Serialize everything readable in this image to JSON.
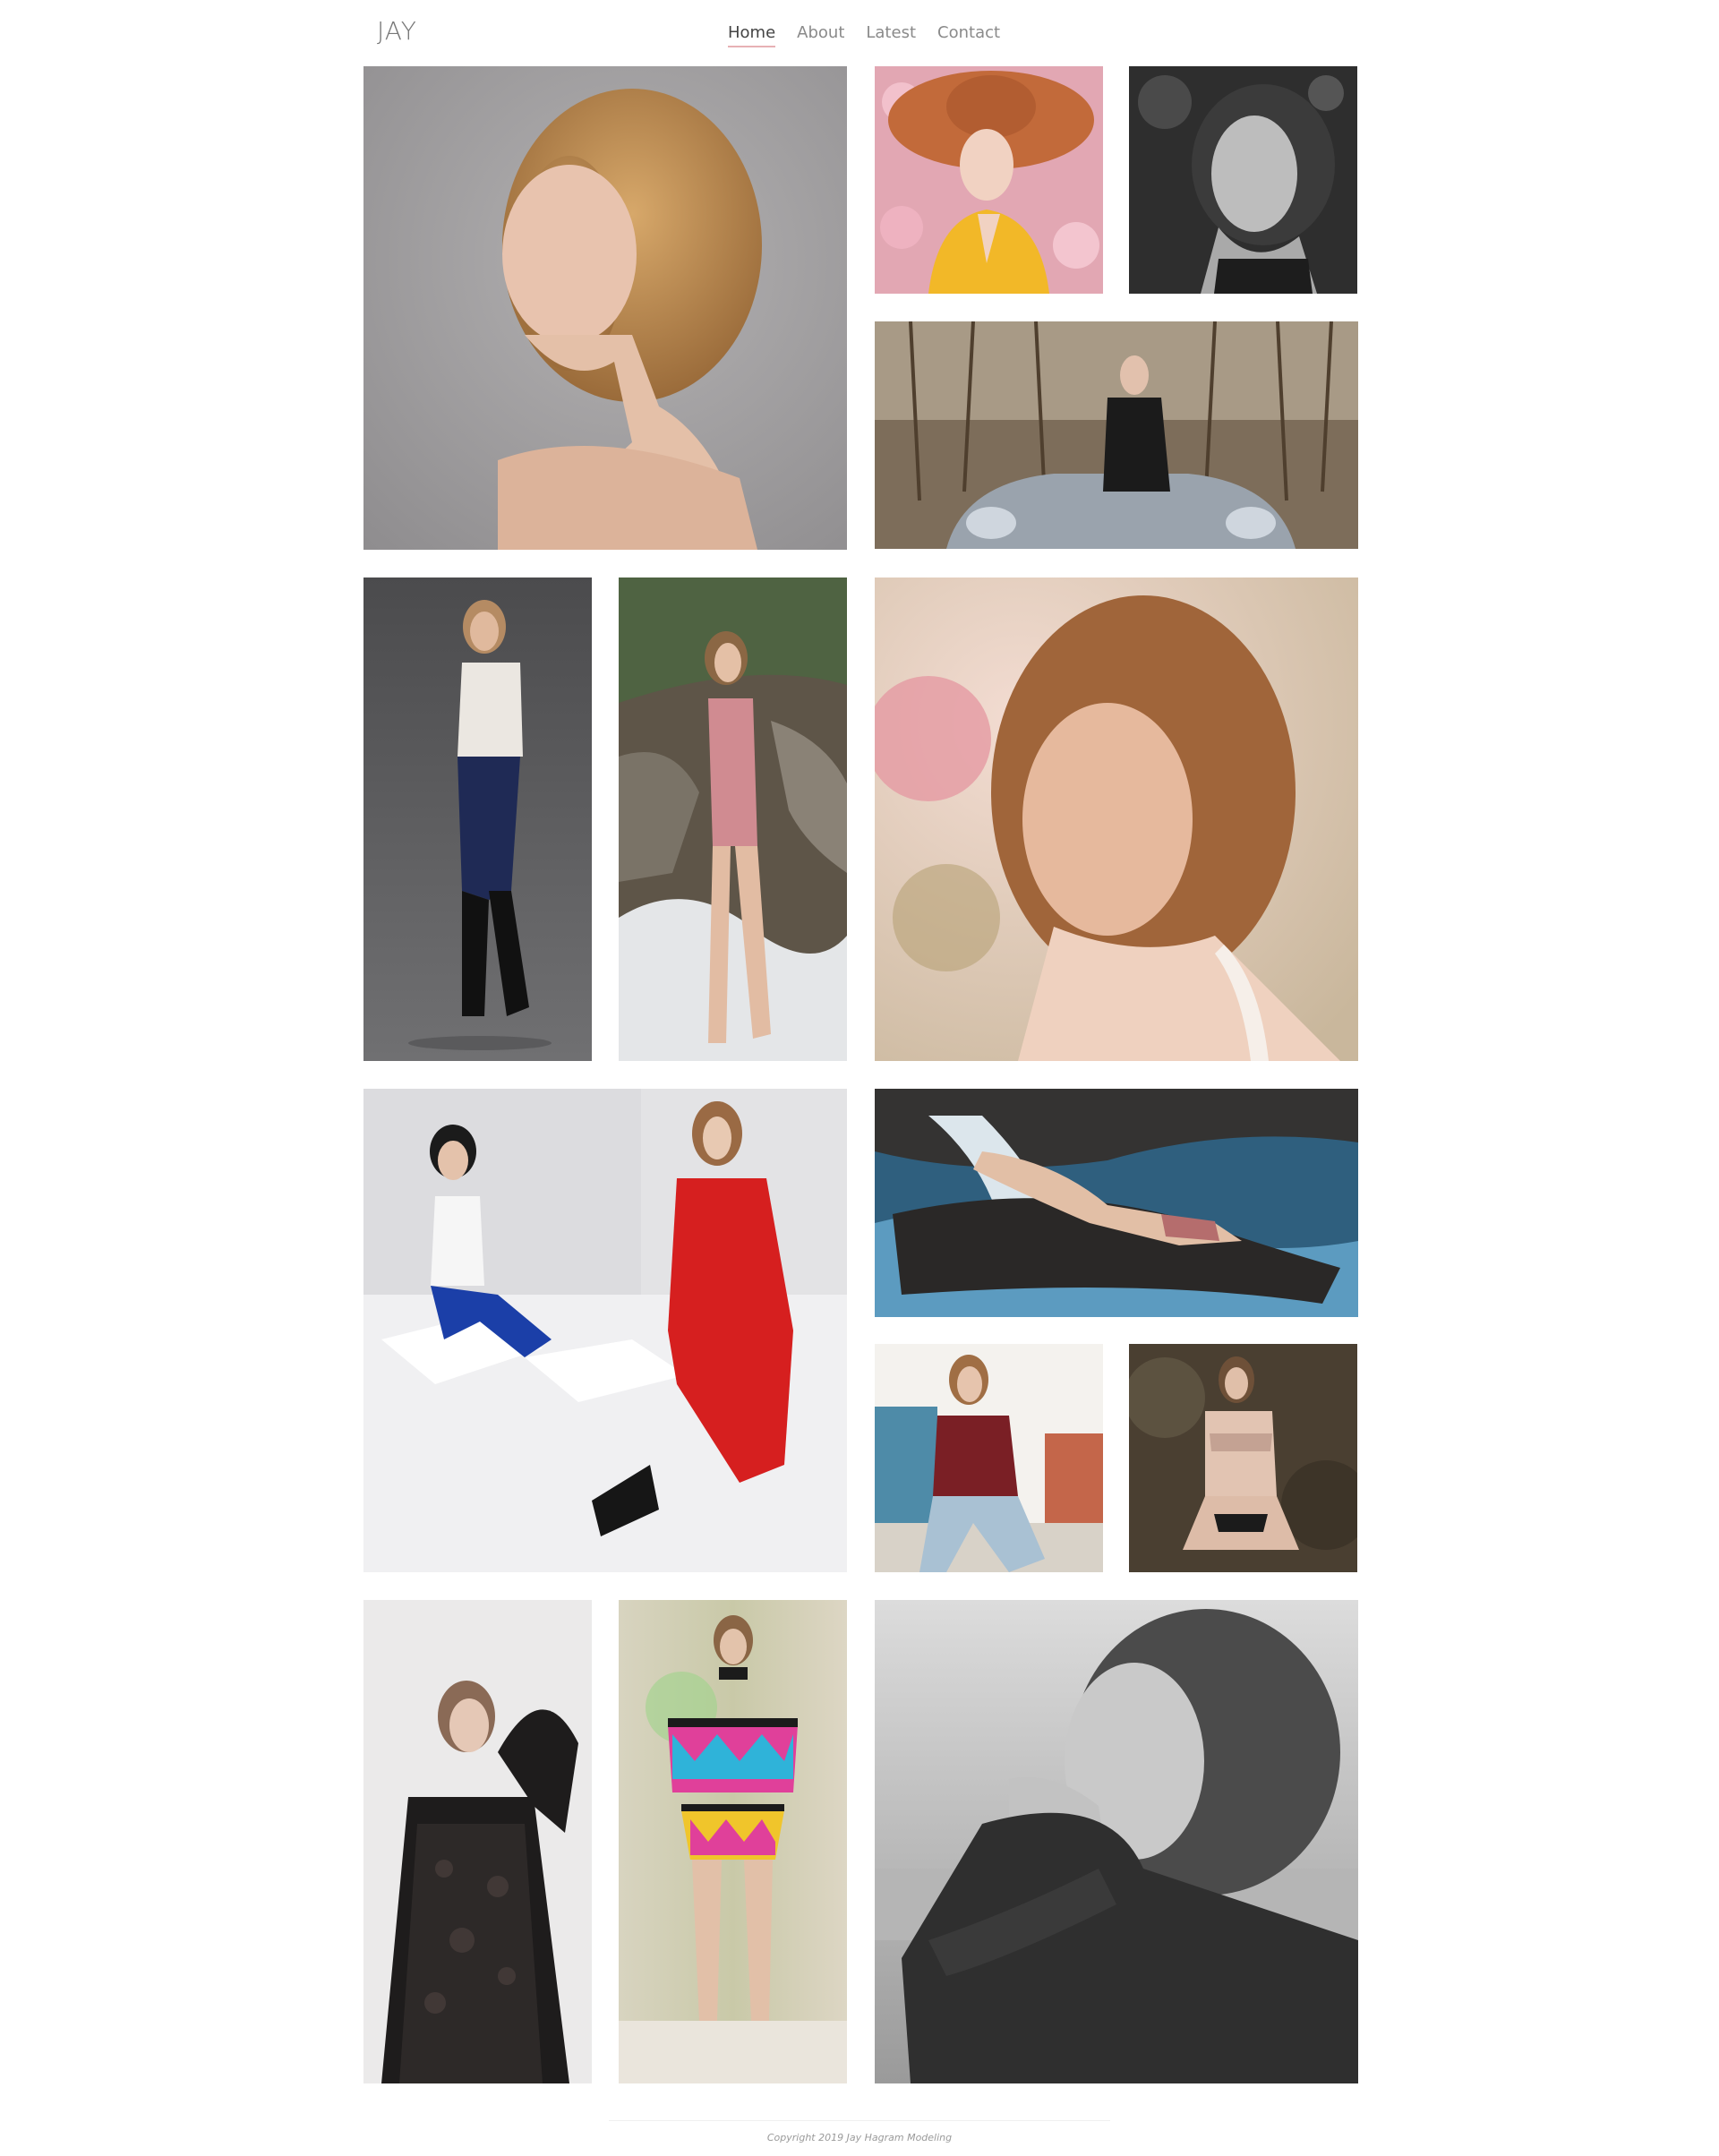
{
  "header": {
    "logo": "JAY",
    "nav": [
      {
        "label": "Home",
        "active": true
      },
      {
        "label": "About",
        "active": false
      },
      {
        "label": "Latest",
        "active": false
      },
      {
        "label": "Contact",
        "active": false
      }
    ]
  },
  "gallery": {
    "photos": [
      {
        "subject": "portrait-shoulders-grey-backdrop",
        "tone": "color"
      },
      {
        "subject": "orange-hat-yellow-dress-pink-roses",
        "tone": "color"
      },
      {
        "subject": "portrait-black-and-white",
        "tone": "monochrome"
      },
      {
        "subject": "seated-on-car-forest",
        "tone": "color"
      },
      {
        "subject": "full-length-white-blouse-boots",
        "tone": "color"
      },
      {
        "subject": "pink-bodysuit-waterfall-rocks",
        "tone": "color"
      },
      {
        "subject": "close-portrait-warm-light",
        "tone": "color"
      },
      {
        "subject": "two-models-red-blue-white-blocks",
        "tone": "color"
      },
      {
        "subject": "reclining-on-rock-by-water",
        "tone": "color"
      },
      {
        "subject": "red-sweater-rooftop",
        "tone": "color"
      },
      {
        "subject": "lace-lingerie-forest",
        "tone": "color"
      },
      {
        "subject": "black-lace-dress-studio",
        "tone": "color"
      },
      {
        "subject": "runway-geometric-print-set",
        "tone": "color"
      },
      {
        "subject": "portrait-black-and-white-sweater",
        "tone": "monochrome"
      }
    ]
  },
  "footer": {
    "copyright": "Copyright 2019 Jay Hagram Modeling"
  },
  "colors": {
    "background": "#ffffff",
    "nav_text": "#8a8a8a",
    "nav_active_text": "#444444",
    "nav_active_underline": "#e7b1b5",
    "logo": "#777777"
  }
}
